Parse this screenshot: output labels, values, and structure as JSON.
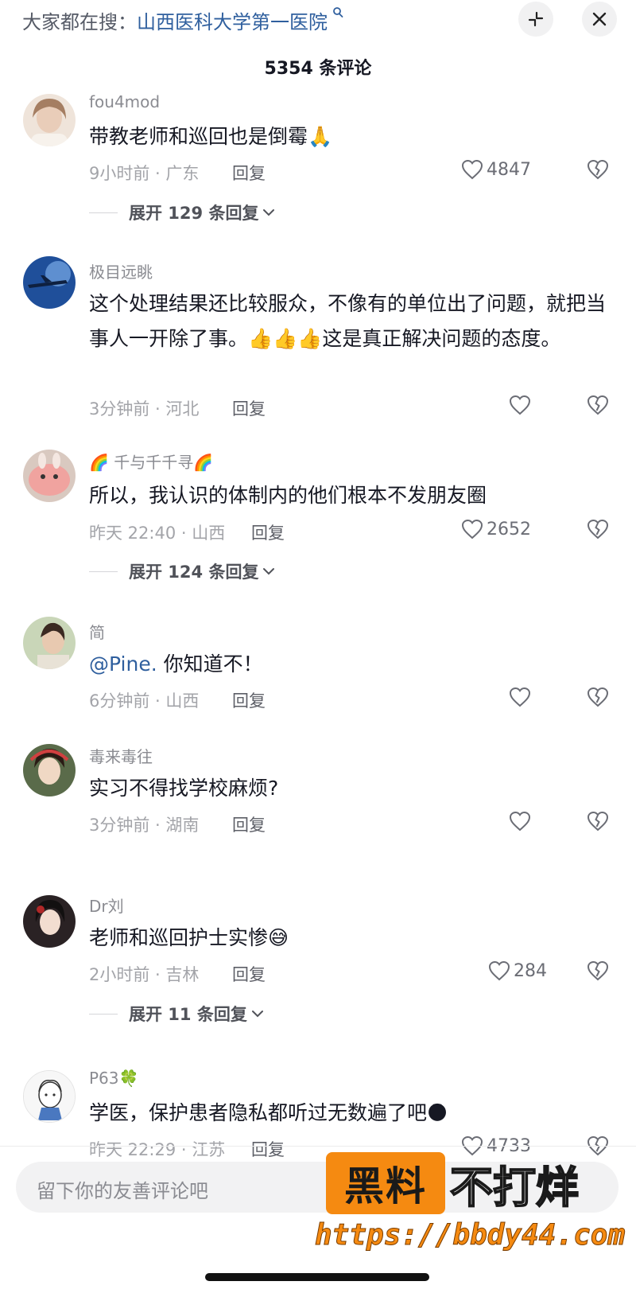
{
  "header": {
    "search_prefix": "大家都在搜：",
    "search_keyword": "山西医科大学第一医院",
    "comment_count": "5354 条评论"
  },
  "comments": [
    {
      "username": "fou4mod",
      "text": "带教老师和巡回也是倒霉🙏",
      "meta": "9小时前 · 广东",
      "reply": "回复",
      "likes": "4847",
      "expand": "展开 129 条回复",
      "avatar_color": "#d8c2b0"
    },
    {
      "username": "极目远眺",
      "text": "这个处理结果还比较服众，不像有的单位出了问题，就把当事人一开除了事。👍👍👍这是真正解决问题的态度。",
      "meta": "3分钟前 · 河北",
      "reply": "回复",
      "likes": "",
      "avatar_color": "#1e5aa8"
    },
    {
      "username": "🌈 千与千千寻🌈",
      "text": "所以，我认识的体制内的他们根本不发朋友圈",
      "meta": "昨天 22:40 · 山西",
      "reply": "回复",
      "likes": "2652",
      "expand": "展开 124 条回复",
      "avatar_color": "#e8a7a3"
    },
    {
      "username": "简",
      "mention": "@Pine.",
      "text": " 你知道不！",
      "meta": "6分钟前 · 山西",
      "reply": "回复",
      "likes": "",
      "avatar_color": "#b7c7a5"
    },
    {
      "username": "毒来毒往",
      "text": "实习不得找学校麻烦?",
      "meta": "3分钟前 · 湖南",
      "reply": "回复",
      "likes": "",
      "avatar_color": "#6b4a3a"
    },
    {
      "username": "Dr刘",
      "text": "老师和巡回护士实惨😅",
      "meta": "2小时前 · 吉林",
      "reply": "回复",
      "likes": "284",
      "expand": "展开 11 条回复",
      "avatar_color": "#3a2a2a"
    },
    {
      "username": "P63🍀",
      "text": "学医，保护患者隐私都听过无数遍了吧🌑",
      "meta": "昨天 22:29 · 江苏",
      "reply": "回复",
      "likes": "4733",
      "avatar_color": "#f4f4f4"
    }
  ],
  "input": {
    "placeholder": "留下你的友善评论吧"
  },
  "watermark": {
    "logo": "黑料",
    "text": "不打烊",
    "url": "https://bbdy44.com"
  }
}
